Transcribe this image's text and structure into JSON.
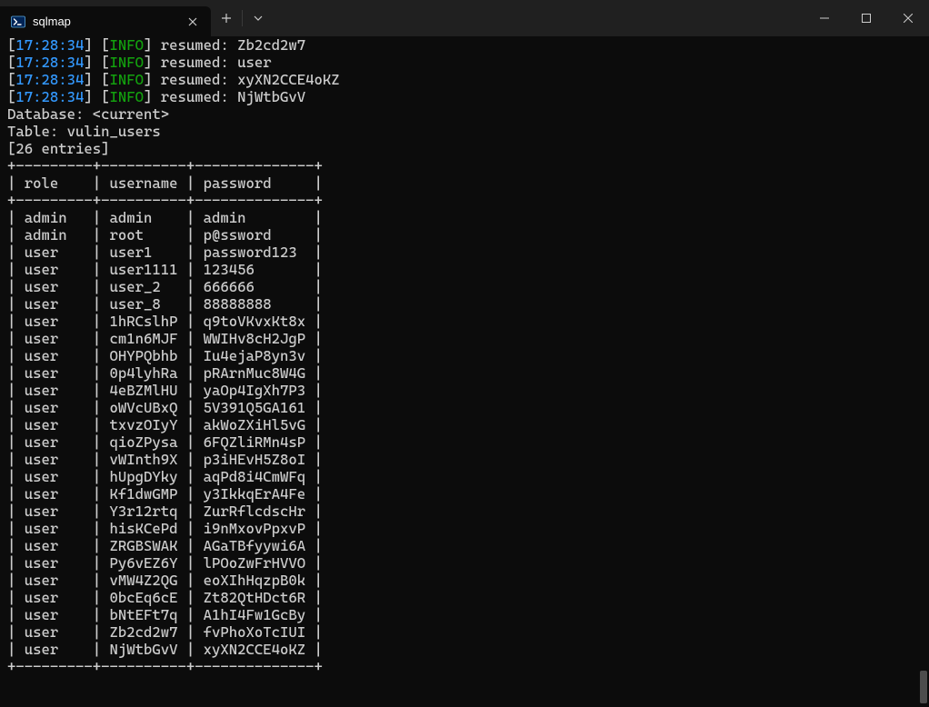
{
  "titlebar": {
    "tab_title": "sqlmap"
  },
  "log": {
    "timestamp": "17:28:34",
    "level": "INFO",
    "action": "resumed:",
    "values": [
      "Zb2cd2w7",
      "user",
      "xyXN2CCE4oKZ",
      "NjWtbGvV"
    ]
  },
  "meta": {
    "database_label": "Database:",
    "database_value": "<current>",
    "table_label": "Table:",
    "table_value": "vulin_users",
    "entries_label": "[26 entries]"
  },
  "table": {
    "border": "+---------+----------+--------------+",
    "header_row": "| role    | username | password     |",
    "headers": [
      "role",
      "username",
      "password"
    ],
    "rows": [
      [
        "admin",
        "admin",
        "admin"
      ],
      [
        "admin",
        "root",
        "p@ssword"
      ],
      [
        "user",
        "user1",
        "password123"
      ],
      [
        "user",
        "user1111",
        "123456"
      ],
      [
        "user",
        "user_2",
        "666666"
      ],
      [
        "user",
        "user_8",
        "88888888"
      ],
      [
        "user",
        "1hRCslhP",
        "q9toVKvxKt8x"
      ],
      [
        "user",
        "cm1n6MJF",
        "WWIHv8cH2JgP"
      ],
      [
        "user",
        "OHYPQbhb",
        "Iu4ejaP8yn3v"
      ],
      [
        "user",
        "0p4lyhRa",
        "pRArnMuc8W4G"
      ],
      [
        "user",
        "4eBZMlHU",
        "yaOp4IgXh7P3"
      ],
      [
        "user",
        "oWVcUBxQ",
        "5V391Q5GA161"
      ],
      [
        "user",
        "txvzOIyY",
        "akWoZXiHl5vG"
      ],
      [
        "user",
        "qioZPysa",
        "6FQZliRMn4sP"
      ],
      [
        "user",
        "vWInth9X",
        "p3iHEvH5Z8oI"
      ],
      [
        "user",
        "hUpgDYky",
        "aqPd8i4CmWFq"
      ],
      [
        "user",
        "Kf1dwGMP",
        "y3IkkqErA4Fe"
      ],
      [
        "user",
        "Y3r12rtq",
        "ZurRflcdscHr"
      ],
      [
        "user",
        "hisKCePd",
        "i9nMxovPpxvP"
      ],
      [
        "user",
        "ZRGBSWAK",
        "AGaTBfyywi6A"
      ],
      [
        "user",
        "Py6vEZ6Y",
        "lPOoZwFrHVVO"
      ],
      [
        "user",
        "vMW4Z2QG",
        "eoXIhHqzpB0k"
      ],
      [
        "user",
        "0bcEq6cE",
        "Zt82QtHDct6R"
      ],
      [
        "user",
        "bNtEFt7q",
        "A1hI4Fw1GcBy"
      ],
      [
        "user",
        "Zb2cd2w7",
        "fvPhoXoTcIUI"
      ],
      [
        "user",
        "NjWtbGvV",
        "xyXN2CCE4oKZ"
      ]
    ]
  }
}
